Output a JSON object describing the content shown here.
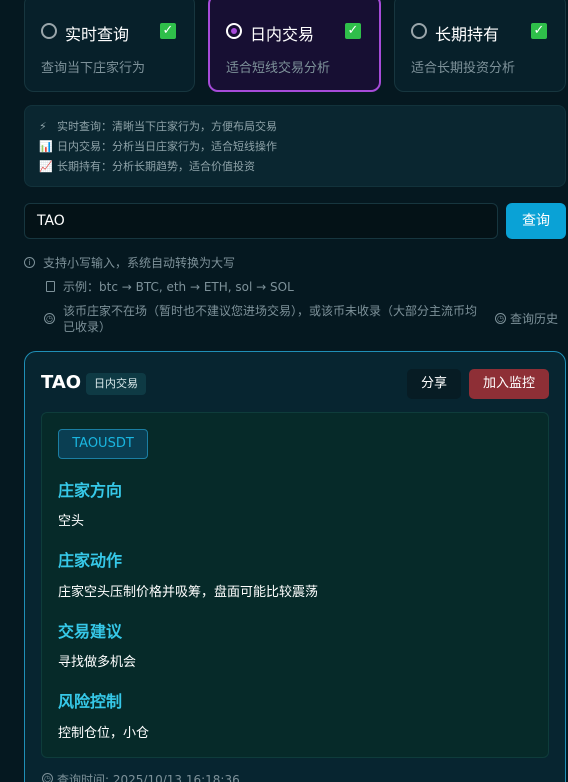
{
  "modes": [
    {
      "title": "实时查询",
      "desc": "查询当下庄家行为",
      "selected": false,
      "checked": true
    },
    {
      "title": "日内交易",
      "desc": "适合短线交易分析",
      "selected": true,
      "checked": true
    },
    {
      "title": "长期持有",
      "desc": "适合长期投资分析",
      "selected": false,
      "checked": true
    }
  ],
  "tips": [
    {
      "icon": "⚡",
      "text": "实时查询：清晰当下庄家行为，方便布局交易"
    },
    {
      "icon": "📊",
      "text": "日内交易：分析当日庄家行为，适合短线操作"
    },
    {
      "icon": "📈",
      "text": "长期持有：分析长期趋势，适合价值投资"
    }
  ],
  "search": {
    "value": "TAO",
    "button": "查询"
  },
  "hints": {
    "lowercase": "支持小写输入，系统自动转换为大写",
    "example": "示例：btc → BTC, eth → ETH, sol → SOL",
    "warning_line1": "该币庄家不在场（暂时也不建议您进场交易），或该币未收录（大部分主流币均",
    "warning_line2": "已收录）",
    "history": "查询历史"
  },
  "result": {
    "symbol": "TAO",
    "mode_badge": "日内交易",
    "share": "分享",
    "monitor": "加入监控",
    "pair": "TAOUSDT",
    "sections": [
      {
        "title": "庄家方向",
        "value": "空头"
      },
      {
        "title": "庄家动作",
        "value": "庄家空头压制价格并吸筹，盘面可能比较震荡"
      },
      {
        "title": "交易建议",
        "value": "寻找做多机会"
      },
      {
        "title": "风险控制",
        "value": "控制仓位，小仓"
      }
    ],
    "query_time": "查询时间: 2025/10/13 16:18:36"
  },
  "colors": {
    "accent": "#a64bd8",
    "primary": "#0aa2d6",
    "danger": "#8e2f36",
    "section_title": "#36c8e8"
  }
}
